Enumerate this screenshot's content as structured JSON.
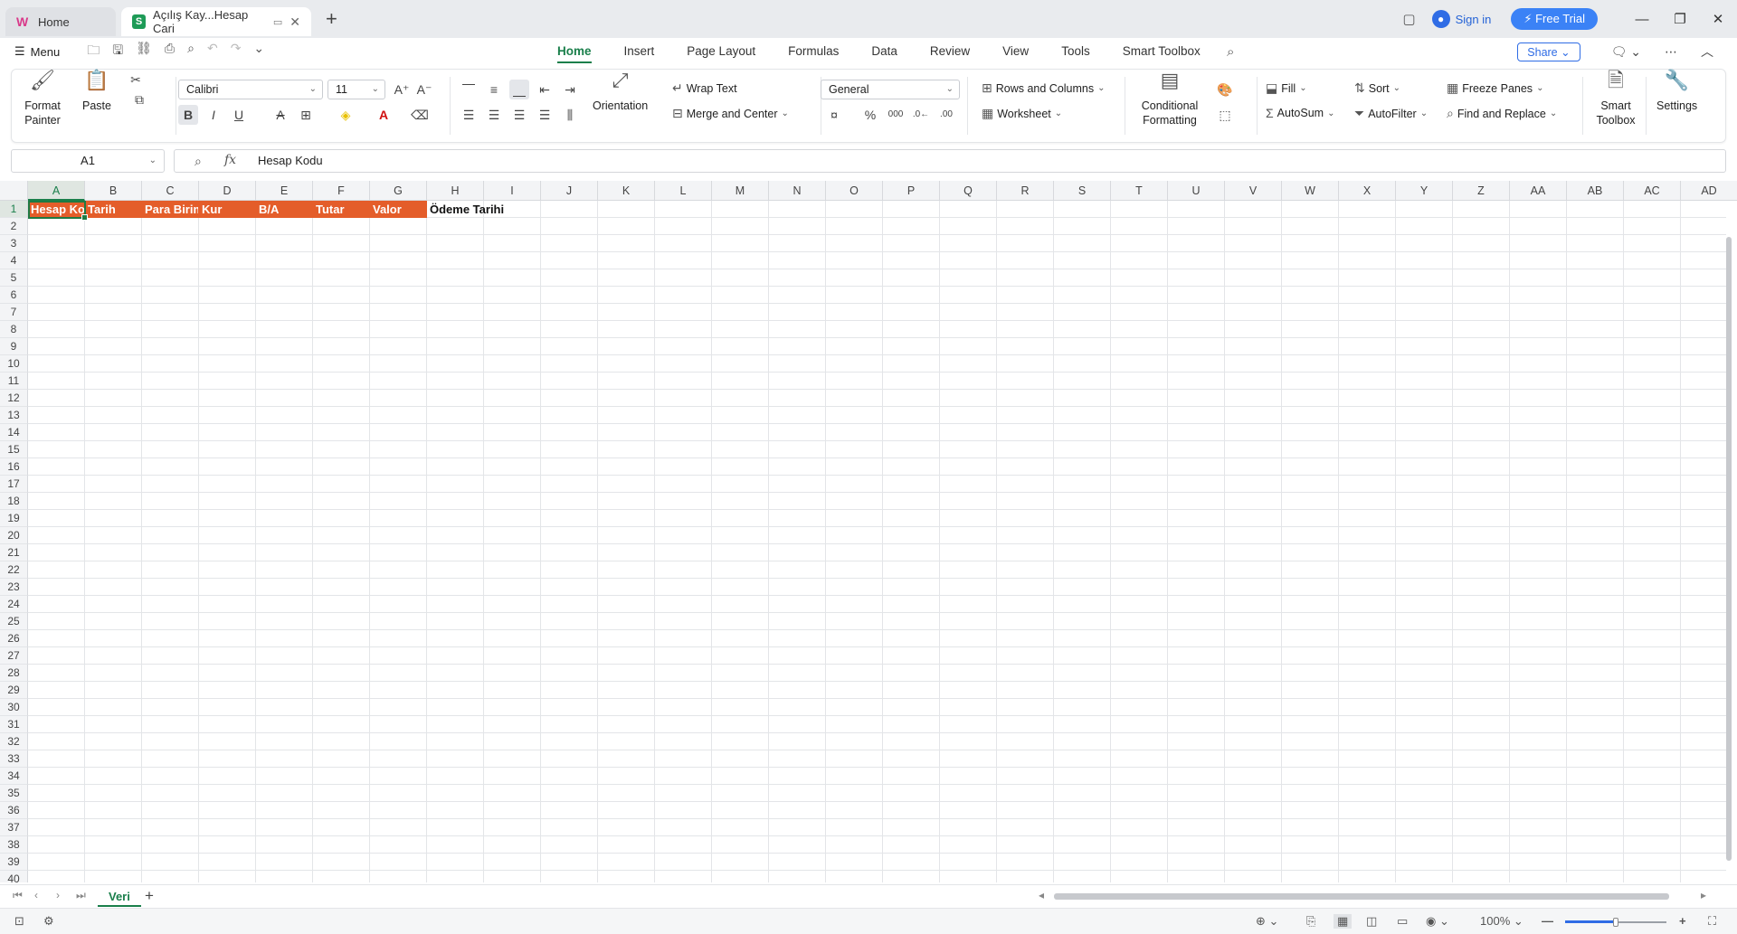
{
  "tabs": {
    "home": "Home",
    "document": "Açılış Kay...Hesap Cari"
  },
  "title_right": {
    "sign_in": "Sign in",
    "free_trial": "Free Trial"
  },
  "menu": {
    "menu_label": "Menu",
    "ribbon_tabs": [
      "Home",
      "Insert",
      "Page Layout",
      "Formulas",
      "Data",
      "Review",
      "View",
      "Tools",
      "Smart Toolbox"
    ],
    "active_tab": "Home",
    "share": "Share"
  },
  "ribbon": {
    "format_painter": "Format Painter",
    "paste": "Paste",
    "font_name": "Calibri",
    "font_size": "11",
    "orientation": "Orientation",
    "wrap_text": "Wrap Text",
    "merge_center": "Merge and Center",
    "number_format": "General",
    "rows_columns": "Rows and Columns",
    "worksheet": "Worksheet",
    "conditional_formatting": "Conditional Formatting",
    "fill": "Fill",
    "autosum": "AutoSum",
    "sort": "Sort",
    "autofilter": "AutoFilter",
    "freeze_panes": "Freeze Panes",
    "find_replace": "Find and Replace",
    "smart_toolbox": "Smart Toolbox",
    "settings": "Settings"
  },
  "formula_bar": {
    "name_box": "A1",
    "fx": "fx",
    "content": "Hesap Kodu"
  },
  "columns": [
    "A",
    "B",
    "C",
    "D",
    "E",
    "F",
    "G",
    "H",
    "I",
    "J",
    "K",
    "L",
    "M",
    "N",
    "O",
    "P",
    "Q",
    "R",
    "S",
    "T",
    "U",
    "V",
    "W",
    "X",
    "Y",
    "Z",
    "AA",
    "AB",
    "AC",
    "AD"
  ],
  "rows": [
    "1",
    "2",
    "3",
    "4",
    "5",
    "6",
    "7",
    "8",
    "9",
    "10",
    "11",
    "12",
    "13",
    "14",
    "15",
    "16",
    "17",
    "18",
    "19",
    "20",
    "21",
    "22",
    "23",
    "24",
    "25",
    "26",
    "27",
    "28",
    "29",
    "30",
    "31",
    "32",
    "33",
    "34",
    "35",
    "36",
    "37",
    "38",
    "39",
    "40"
  ],
  "row1": {
    "A": "Hesap Kodu",
    "B": "Tarih",
    "C": "Para Birimi",
    "D": "Kur",
    "E": "B/A",
    "F": "Tutar",
    "G": "Valor",
    "H": "Ödeme Tarihi"
  },
  "header_fill_color": "#e45d2a",
  "sheet_tabs": [
    "Veri"
  ],
  "status": {
    "zoom": "100%"
  }
}
